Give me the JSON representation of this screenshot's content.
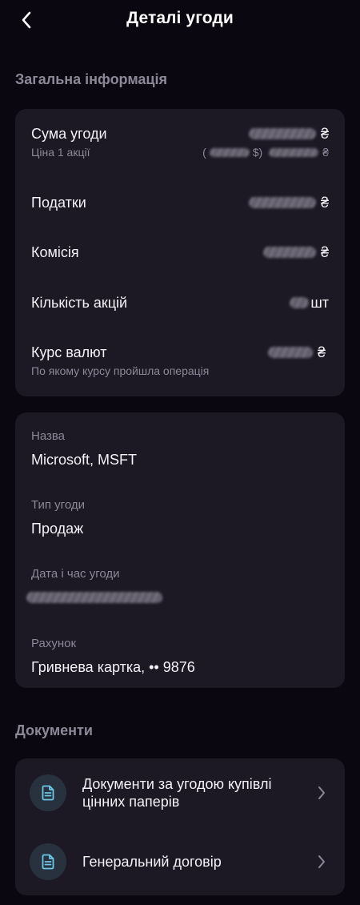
{
  "header": {
    "title": "Деталі угоди",
    "back_icon": "chevron-left-icon"
  },
  "general": {
    "section_title": "Загальна інформація",
    "deal_amount": {
      "label": "Сума угоди",
      "currency": "₴"
    },
    "share_price": {
      "label": "Ціна 1 акції",
      "open_paren": "(",
      "usd_suffix": "$)",
      "currency": "₴"
    },
    "taxes": {
      "label": "Податки",
      "currency": "₴"
    },
    "commission": {
      "label": "Комісія",
      "currency": "₴"
    },
    "shares_count": {
      "label": "Кількість акцій",
      "unit": "шт"
    },
    "exchange_rate": {
      "label": "Курс валют",
      "sublabel": "По якому курсу пройшла операція",
      "currency": "₴"
    }
  },
  "details": {
    "name": {
      "label": "Назва",
      "value": "Microsoft, MSFT"
    },
    "deal_type": {
      "label": "Тип угоди",
      "value": "Продаж"
    },
    "datetime": {
      "label": "Дата і час угоди"
    },
    "account": {
      "label": "Рахунок",
      "value": "Гривнева картка, •• 9876"
    }
  },
  "documents": {
    "section_title": "Документи",
    "items": [
      {
        "label": "Документи за угодою купівлі цінних паперів",
        "icon": "document-icon"
      },
      {
        "label": "Генеральний договір",
        "icon": "document-icon"
      }
    ]
  },
  "colors": {
    "background": "#0b0710",
    "card": "#1c1824",
    "muted_text": "#8d8898",
    "icon_accent": "#6fc6e8"
  }
}
